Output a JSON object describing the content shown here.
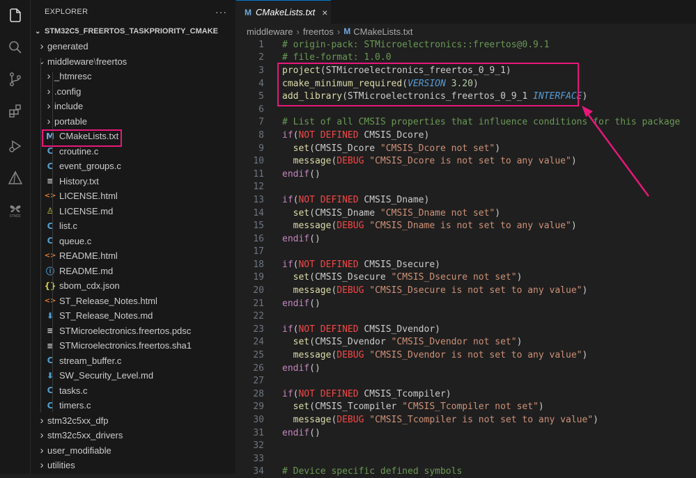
{
  "explorer": {
    "header": "EXPLORER",
    "more": "···",
    "project": "STM32C5_FREERTOS_TASKPRIORITY_CMAKE",
    "tree": [
      {
        "label": "generated",
        "indent": 1,
        "chev": "›",
        "icon": ""
      },
      {
        "label": "middleware",
        "label2": "freertos",
        "indent": 1,
        "chev": "⌄",
        "icon": ""
      },
      {
        "label": "_htmresc",
        "indent": 2,
        "chev": "›",
        "icon": ""
      },
      {
        "label": ".config",
        "indent": 2,
        "chev": "›",
        "icon": ""
      },
      {
        "label": "include",
        "indent": 2,
        "chev": "›",
        "icon": ""
      },
      {
        "label": "portable",
        "indent": 2,
        "chev": "›",
        "icon": ""
      },
      {
        "label": "CMakeLists.txt",
        "indent": 2,
        "chev": "",
        "icon": "M",
        "color": "#6fa8dc",
        "selected": true
      },
      {
        "label": "croutine.c",
        "indent": 2,
        "chev": "",
        "icon": "C",
        "color": "#4ea1d3"
      },
      {
        "label": "event_groups.c",
        "indent": 2,
        "chev": "",
        "icon": "C",
        "color": "#4ea1d3"
      },
      {
        "label": "History.txt",
        "indent": 2,
        "chev": "",
        "icon": "≡",
        "color": "#cccccc"
      },
      {
        "label": "LICENSE.html",
        "indent": 2,
        "chev": "",
        "icon": "<>",
        "color": "#e37933"
      },
      {
        "label": "LICENSE.md",
        "indent": 2,
        "chev": "",
        "icon": "♙",
        "color": "#cbcb41"
      },
      {
        "label": "list.c",
        "indent": 2,
        "chev": "",
        "icon": "C",
        "color": "#4ea1d3"
      },
      {
        "label": "queue.c",
        "indent": 2,
        "chev": "",
        "icon": "C",
        "color": "#4ea1d3"
      },
      {
        "label": "README.html",
        "indent": 2,
        "chev": "",
        "icon": "<>",
        "color": "#e37933"
      },
      {
        "label": "README.md",
        "indent": 2,
        "chev": "",
        "icon": "ⓘ",
        "color": "#4ea1d3"
      },
      {
        "label": "sbom_cdx.json",
        "indent": 2,
        "chev": "",
        "icon": "{}",
        "color": "#cbcb41"
      },
      {
        "label": "ST_Release_Notes.html",
        "indent": 2,
        "chev": "",
        "icon": "<>",
        "color": "#e37933"
      },
      {
        "label": "ST_Release_Notes.md",
        "indent": 2,
        "chev": "",
        "icon": "⬇",
        "color": "#4ea1d3"
      },
      {
        "label": "STMicroelectronics.freertos.pdsc",
        "indent": 2,
        "chev": "",
        "icon": "≡",
        "color": "#cccccc"
      },
      {
        "label": "STMicroelectronics.freertos.sha1",
        "indent": 2,
        "chev": "",
        "icon": "≡",
        "color": "#cccccc"
      },
      {
        "label": "stream_buffer.c",
        "indent": 2,
        "chev": "",
        "icon": "C",
        "color": "#4ea1d3"
      },
      {
        "label": "SW_Security_Level.md",
        "indent": 2,
        "chev": "",
        "icon": "⬇",
        "color": "#4ea1d3"
      },
      {
        "label": "tasks.c",
        "indent": 2,
        "chev": "",
        "icon": "C",
        "color": "#4ea1d3"
      },
      {
        "label": "timers.c",
        "indent": 2,
        "chev": "",
        "icon": "C",
        "color": "#4ea1d3"
      },
      {
        "label": "stm32c5xx_dfp",
        "indent": 1,
        "chev": "›",
        "icon": ""
      },
      {
        "label": "stm32c5xx_drivers",
        "indent": 1,
        "chev": "›",
        "icon": ""
      },
      {
        "label": "user_modifiable",
        "indent": 1,
        "chev": "›",
        "icon": ""
      },
      {
        "label": "utilities",
        "indent": 1,
        "chev": "›",
        "icon": ""
      }
    ]
  },
  "editor": {
    "tab_label": "CMakeLists.txt",
    "tab_icon": "M",
    "tab_close": "×",
    "breadcrumb": [
      "middleware",
      "freertos",
      "CMakeLists.txt"
    ],
    "breadcrumb_sep": "›",
    "lines": [
      {
        "n": "1",
        "tokens": [
          [
            "c-comment",
            "# origin-pack: STMicroelectronics::freertos@0.9.1"
          ]
        ]
      },
      {
        "n": "2",
        "tokens": [
          [
            "c-comment",
            "# file-format: 1.0.0"
          ]
        ]
      },
      {
        "n": "3",
        "tokens": [
          [
            "c-fn",
            "project"
          ],
          [
            "c-def",
            "(STMicroelectronics_freertos_0_9_1)"
          ]
        ]
      },
      {
        "n": "4",
        "tokens": [
          [
            "c-fn",
            "cmake_minimum_required"
          ],
          [
            "c-def",
            "("
          ],
          [
            "c-var2",
            "VERSION"
          ],
          [
            "c-def",
            " "
          ],
          [
            "c-num",
            "3.20"
          ],
          [
            "c-def",
            ")"
          ]
        ]
      },
      {
        "n": "5",
        "tokens": [
          [
            "c-fn",
            "add_library"
          ],
          [
            "c-def",
            "(STMicroelectronics_freertos_0_9_1 "
          ],
          [
            "c-var2",
            "INTERFACE"
          ],
          [
            "c-def",
            ")"
          ]
        ]
      },
      {
        "n": "6",
        "tokens": []
      },
      {
        "n": "7",
        "tokens": [
          [
            "c-comment",
            "# List of all CMSIS properties that influence conditions for this package"
          ]
        ]
      },
      {
        "n": "8",
        "tokens": [
          [
            "c-kw",
            "if"
          ],
          [
            "c-def",
            "("
          ],
          [
            "c-cond",
            "NOT DEFINED"
          ],
          [
            "c-def",
            " CMSIS_Dcore)"
          ]
        ]
      },
      {
        "n": "9",
        "tokens": [
          [
            "c-def",
            "  "
          ],
          [
            "c-fn",
            "set"
          ],
          [
            "c-def",
            "(CMSIS_Dcore "
          ],
          [
            "c-str",
            "\"CMSIS_Dcore not set\""
          ],
          [
            "c-def",
            ")"
          ]
        ]
      },
      {
        "n": "10",
        "tokens": [
          [
            "c-def",
            "  "
          ],
          [
            "c-fn",
            "message"
          ],
          [
            "c-def",
            "("
          ],
          [
            "c-cond",
            "DEBUG"
          ],
          [
            "c-def",
            " "
          ],
          [
            "c-str",
            "\"CMSIS_Dcore is not set to any value\""
          ],
          [
            "c-def",
            ")"
          ]
        ]
      },
      {
        "n": "11",
        "tokens": [
          [
            "c-kw",
            "endif"
          ],
          [
            "c-def",
            "()"
          ]
        ]
      },
      {
        "n": "12",
        "tokens": []
      },
      {
        "n": "13",
        "tokens": [
          [
            "c-kw",
            "if"
          ],
          [
            "c-def",
            "("
          ],
          [
            "c-cond",
            "NOT DEFINED"
          ],
          [
            "c-def",
            " CMSIS_Dname)"
          ]
        ]
      },
      {
        "n": "14",
        "tokens": [
          [
            "c-def",
            "  "
          ],
          [
            "c-fn",
            "set"
          ],
          [
            "c-def",
            "(CMSIS_Dname "
          ],
          [
            "c-str",
            "\"CMSIS_Dname not set\""
          ],
          [
            "c-def",
            ")"
          ]
        ]
      },
      {
        "n": "15",
        "tokens": [
          [
            "c-def",
            "  "
          ],
          [
            "c-fn",
            "message"
          ],
          [
            "c-def",
            "("
          ],
          [
            "c-cond",
            "DEBUG"
          ],
          [
            "c-def",
            " "
          ],
          [
            "c-str",
            "\"CMSIS_Dname is not set to any value\""
          ],
          [
            "c-def",
            ")"
          ]
        ]
      },
      {
        "n": "16",
        "tokens": [
          [
            "c-kw",
            "endif"
          ],
          [
            "c-def",
            "()"
          ]
        ]
      },
      {
        "n": "17",
        "tokens": []
      },
      {
        "n": "18",
        "tokens": [
          [
            "c-kw",
            "if"
          ],
          [
            "c-def",
            "("
          ],
          [
            "c-cond",
            "NOT DEFINED"
          ],
          [
            "c-def",
            " CMSIS_Dsecure)"
          ]
        ]
      },
      {
        "n": "19",
        "tokens": [
          [
            "c-def",
            "  "
          ],
          [
            "c-fn",
            "set"
          ],
          [
            "c-def",
            "(CMSIS_Dsecure "
          ],
          [
            "c-str",
            "\"CMSIS_Dsecure not set\""
          ],
          [
            "c-def",
            ")"
          ]
        ]
      },
      {
        "n": "20",
        "tokens": [
          [
            "c-def",
            "  "
          ],
          [
            "c-fn",
            "message"
          ],
          [
            "c-def",
            "("
          ],
          [
            "c-cond",
            "DEBUG"
          ],
          [
            "c-def",
            " "
          ],
          [
            "c-str",
            "\"CMSIS_Dsecure is not set to any value\""
          ],
          [
            "c-def",
            ")"
          ]
        ]
      },
      {
        "n": "21",
        "tokens": [
          [
            "c-kw",
            "endif"
          ],
          [
            "c-def",
            "()"
          ]
        ]
      },
      {
        "n": "22",
        "tokens": []
      },
      {
        "n": "23",
        "tokens": [
          [
            "c-kw",
            "if"
          ],
          [
            "c-def",
            "("
          ],
          [
            "c-cond",
            "NOT DEFINED"
          ],
          [
            "c-def",
            " CMSIS_Dvendor)"
          ]
        ]
      },
      {
        "n": "24",
        "tokens": [
          [
            "c-def",
            "  "
          ],
          [
            "c-fn",
            "set"
          ],
          [
            "c-def",
            "(CMSIS_Dvendor "
          ],
          [
            "c-str",
            "\"CMSIS_Dvendor not set\""
          ],
          [
            "c-def",
            ")"
          ]
        ]
      },
      {
        "n": "25",
        "tokens": [
          [
            "c-def",
            "  "
          ],
          [
            "c-fn",
            "message"
          ],
          [
            "c-def",
            "("
          ],
          [
            "c-cond",
            "DEBUG"
          ],
          [
            "c-def",
            " "
          ],
          [
            "c-str",
            "\"CMSIS_Dvendor is not set to any value\""
          ],
          [
            "c-def",
            ")"
          ]
        ]
      },
      {
        "n": "26",
        "tokens": [
          [
            "c-kw",
            "endif"
          ],
          [
            "c-def",
            "()"
          ]
        ]
      },
      {
        "n": "27",
        "tokens": []
      },
      {
        "n": "28",
        "tokens": [
          [
            "c-kw",
            "if"
          ],
          [
            "c-def",
            "("
          ],
          [
            "c-cond",
            "NOT DEFINED"
          ],
          [
            "c-def",
            " CMSIS_Tcompiler)"
          ]
        ]
      },
      {
        "n": "29",
        "tokens": [
          [
            "c-def",
            "  "
          ],
          [
            "c-fn",
            "set"
          ],
          [
            "c-def",
            "(CMSIS_Tcompiler "
          ],
          [
            "c-str",
            "\"CMSIS_Tcompiler not set\""
          ],
          [
            "c-def",
            ")"
          ]
        ]
      },
      {
        "n": "30",
        "tokens": [
          [
            "c-def",
            "  "
          ],
          [
            "c-fn",
            "message"
          ],
          [
            "c-def",
            "("
          ],
          [
            "c-cond",
            "DEBUG"
          ],
          [
            "c-def",
            " "
          ],
          [
            "c-str",
            "\"CMSIS_Tcompiler is not set to any value\""
          ],
          [
            "c-def",
            ")"
          ]
        ]
      },
      {
        "n": "31",
        "tokens": [
          [
            "c-kw",
            "endif"
          ],
          [
            "c-def",
            "()"
          ]
        ]
      },
      {
        "n": "32",
        "tokens": []
      },
      {
        "n": "33",
        "tokens": []
      },
      {
        "n": "34",
        "tokens": [
          [
            "c-comment",
            "# Device specific defined symbols"
          ]
        ]
      }
    ]
  },
  "activity_bar": [
    "explorer-icon",
    "search-icon",
    "source-control-icon",
    "extensions-icon",
    "run-debug-icon",
    "cmake-icon",
    "stm32-icon"
  ],
  "activity_label": "STM32",
  "colors": {
    "annotation": "#e8177a",
    "accent": "#0078d4"
  }
}
